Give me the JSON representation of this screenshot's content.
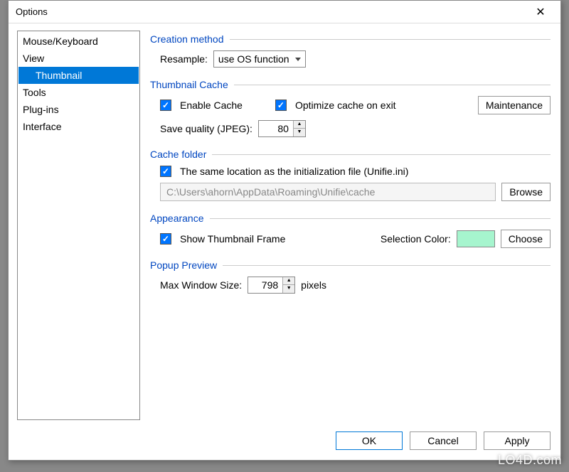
{
  "window": {
    "title": "Options"
  },
  "sidebar": {
    "items": [
      {
        "label": "Mouse/Keyboard",
        "indent": false,
        "selected": false
      },
      {
        "label": "View",
        "indent": false,
        "selected": false
      },
      {
        "label": "Thumbnail",
        "indent": true,
        "selected": true
      },
      {
        "label": "Tools",
        "indent": false,
        "selected": false
      },
      {
        "label": "Plug-ins",
        "indent": false,
        "selected": false
      },
      {
        "label": "Interface",
        "indent": false,
        "selected": false
      }
    ]
  },
  "groups": {
    "creation": {
      "title": "Creation method",
      "resample_label": "Resample:",
      "resample_value": "use OS function"
    },
    "cache": {
      "title": "Thumbnail Cache",
      "enable_label": "Enable Cache",
      "enable_checked": true,
      "optimize_label": "Optimize cache on exit",
      "optimize_checked": true,
      "maintenance_btn": "Maintenance",
      "quality_label": "Save quality (JPEG):",
      "quality_value": "80"
    },
    "folder": {
      "title": "Cache folder",
      "same_loc_label": "The same location as the initialization file (Unifie.ini)",
      "same_loc_checked": true,
      "path": "C:\\Users\\ahorn\\AppData\\Roaming\\Unifie\\cache",
      "browse_btn": "Browse"
    },
    "appearance": {
      "title": "Appearance",
      "frame_label": "Show Thumbnail Frame",
      "frame_checked": true,
      "selcolor_label": "Selection Color:",
      "selcolor_value": "#a6f5ce",
      "choose_btn": "Choose"
    },
    "popup": {
      "title": "Popup Preview",
      "maxwin_label": "Max Window Size:",
      "maxwin_value": "798",
      "pixels_label": "pixels"
    }
  },
  "footer": {
    "ok": "OK",
    "cancel": "Cancel",
    "apply": "Apply"
  },
  "watermark": "LO4D.com"
}
